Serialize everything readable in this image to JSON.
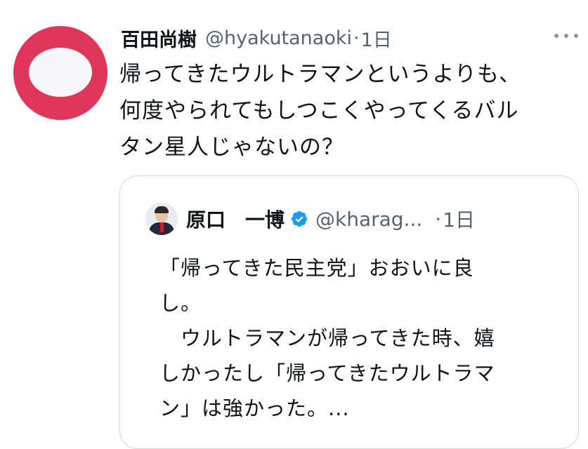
{
  "tweet": {
    "display_name": "百田尚樹",
    "handle": "@hyakutanaoki",
    "separator": "·",
    "time": "1日",
    "more_icon": "more-horizontal-icon",
    "avatar_colors": {
      "ring": "#e0365a",
      "center": "#f7f7fb"
    },
    "text_lines": [
      "帰ってきたウルトラマンというよりも、",
      "何度やられてもしつこくやってくるバル",
      "タン星人じゃないの？"
    ]
  },
  "quoted_tweet": {
    "display_name": "原口　一博",
    "verified_icon": "verified-badge-icon",
    "verified_color": "#1d9bf0",
    "handle": "@kharag...",
    "separator": "·",
    "time": "1日",
    "text_lines": [
      "「帰ってきた民主党」おおいに良",
      "し。",
      "　ウルトラマンが帰ってきた時、嬉",
      "しかったし「帰ってきたウルトラマ",
      "ン」は強かった。..."
    ]
  }
}
